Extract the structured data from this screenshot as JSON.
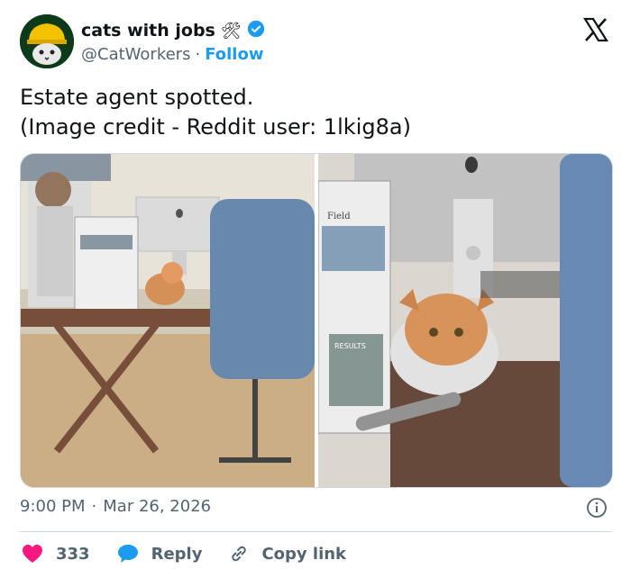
{
  "account": {
    "display_name": "cats with jobs",
    "name_emoji": "🛠",
    "handle": "@CatWorkers",
    "separator": "·",
    "follow_label": "Follow"
  },
  "tweet": {
    "line1": "Estate agent spotted.",
    "line2": "(Image credit - Reddit user: 1lkig8a)"
  },
  "photo_text": {
    "newspaper_headline": "Field",
    "results_label": "RESULTS"
  },
  "timestamp": {
    "time": "9:00 PM",
    "separator": "·",
    "date": "Mar 26, 2026"
  },
  "actions": {
    "like_count": "333",
    "reply_label": "Reply",
    "copy_label": "Copy link"
  },
  "colors": {
    "accent": "#1d9bf0",
    "like": "#f91880",
    "text": "#0f1419",
    "muted": "#536471",
    "border": "#cfd9de"
  }
}
